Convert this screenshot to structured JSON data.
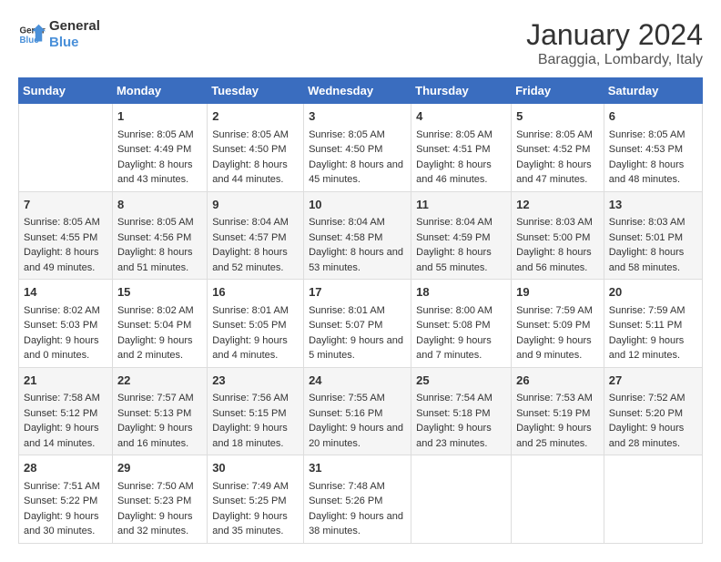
{
  "logo": {
    "line1": "General",
    "line2": "Blue"
  },
  "title": "January 2024",
  "subtitle": "Baraggia, Lombardy, Italy",
  "header": {
    "accent_color": "#3a6dbf"
  },
  "days_of_week": [
    "Sunday",
    "Monday",
    "Tuesday",
    "Wednesday",
    "Thursday",
    "Friday",
    "Saturday"
  ],
  "weeks": [
    [
      {
        "day": "",
        "sunrise": "",
        "sunset": "",
        "daylight": ""
      },
      {
        "day": "1",
        "sunrise": "Sunrise: 8:05 AM",
        "sunset": "Sunset: 4:49 PM",
        "daylight": "Daylight: 8 hours and 43 minutes."
      },
      {
        "day": "2",
        "sunrise": "Sunrise: 8:05 AM",
        "sunset": "Sunset: 4:50 PM",
        "daylight": "Daylight: 8 hours and 44 minutes."
      },
      {
        "day": "3",
        "sunrise": "Sunrise: 8:05 AM",
        "sunset": "Sunset: 4:50 PM",
        "daylight": "Daylight: 8 hours and 45 minutes."
      },
      {
        "day": "4",
        "sunrise": "Sunrise: 8:05 AM",
        "sunset": "Sunset: 4:51 PM",
        "daylight": "Daylight: 8 hours and 46 minutes."
      },
      {
        "day": "5",
        "sunrise": "Sunrise: 8:05 AM",
        "sunset": "Sunset: 4:52 PM",
        "daylight": "Daylight: 8 hours and 47 minutes."
      },
      {
        "day": "6",
        "sunrise": "Sunrise: 8:05 AM",
        "sunset": "Sunset: 4:53 PM",
        "daylight": "Daylight: 8 hours and 48 minutes."
      }
    ],
    [
      {
        "day": "7",
        "sunrise": "Sunrise: 8:05 AM",
        "sunset": "Sunset: 4:55 PM",
        "daylight": "Daylight: 8 hours and 49 minutes."
      },
      {
        "day": "8",
        "sunrise": "Sunrise: 8:05 AM",
        "sunset": "Sunset: 4:56 PM",
        "daylight": "Daylight: 8 hours and 51 minutes."
      },
      {
        "day": "9",
        "sunrise": "Sunrise: 8:04 AM",
        "sunset": "Sunset: 4:57 PM",
        "daylight": "Daylight: 8 hours and 52 minutes."
      },
      {
        "day": "10",
        "sunrise": "Sunrise: 8:04 AM",
        "sunset": "Sunset: 4:58 PM",
        "daylight": "Daylight: 8 hours and 53 minutes."
      },
      {
        "day": "11",
        "sunrise": "Sunrise: 8:04 AM",
        "sunset": "Sunset: 4:59 PM",
        "daylight": "Daylight: 8 hours and 55 minutes."
      },
      {
        "day": "12",
        "sunrise": "Sunrise: 8:03 AM",
        "sunset": "Sunset: 5:00 PM",
        "daylight": "Daylight: 8 hours and 56 minutes."
      },
      {
        "day": "13",
        "sunrise": "Sunrise: 8:03 AM",
        "sunset": "Sunset: 5:01 PM",
        "daylight": "Daylight: 8 hours and 58 minutes."
      }
    ],
    [
      {
        "day": "14",
        "sunrise": "Sunrise: 8:02 AM",
        "sunset": "Sunset: 5:03 PM",
        "daylight": "Daylight: 9 hours and 0 minutes."
      },
      {
        "day": "15",
        "sunrise": "Sunrise: 8:02 AM",
        "sunset": "Sunset: 5:04 PM",
        "daylight": "Daylight: 9 hours and 2 minutes."
      },
      {
        "day": "16",
        "sunrise": "Sunrise: 8:01 AM",
        "sunset": "Sunset: 5:05 PM",
        "daylight": "Daylight: 9 hours and 4 minutes."
      },
      {
        "day": "17",
        "sunrise": "Sunrise: 8:01 AM",
        "sunset": "Sunset: 5:07 PM",
        "daylight": "Daylight: 9 hours and 5 minutes."
      },
      {
        "day": "18",
        "sunrise": "Sunrise: 8:00 AM",
        "sunset": "Sunset: 5:08 PM",
        "daylight": "Daylight: 9 hours and 7 minutes."
      },
      {
        "day": "19",
        "sunrise": "Sunrise: 7:59 AM",
        "sunset": "Sunset: 5:09 PM",
        "daylight": "Daylight: 9 hours and 9 minutes."
      },
      {
        "day": "20",
        "sunrise": "Sunrise: 7:59 AM",
        "sunset": "Sunset: 5:11 PM",
        "daylight": "Daylight: 9 hours and 12 minutes."
      }
    ],
    [
      {
        "day": "21",
        "sunrise": "Sunrise: 7:58 AM",
        "sunset": "Sunset: 5:12 PM",
        "daylight": "Daylight: 9 hours and 14 minutes."
      },
      {
        "day": "22",
        "sunrise": "Sunrise: 7:57 AM",
        "sunset": "Sunset: 5:13 PM",
        "daylight": "Daylight: 9 hours and 16 minutes."
      },
      {
        "day": "23",
        "sunrise": "Sunrise: 7:56 AM",
        "sunset": "Sunset: 5:15 PM",
        "daylight": "Daylight: 9 hours and 18 minutes."
      },
      {
        "day": "24",
        "sunrise": "Sunrise: 7:55 AM",
        "sunset": "Sunset: 5:16 PM",
        "daylight": "Daylight: 9 hours and 20 minutes."
      },
      {
        "day": "25",
        "sunrise": "Sunrise: 7:54 AM",
        "sunset": "Sunset: 5:18 PM",
        "daylight": "Daylight: 9 hours and 23 minutes."
      },
      {
        "day": "26",
        "sunrise": "Sunrise: 7:53 AM",
        "sunset": "Sunset: 5:19 PM",
        "daylight": "Daylight: 9 hours and 25 minutes."
      },
      {
        "day": "27",
        "sunrise": "Sunrise: 7:52 AM",
        "sunset": "Sunset: 5:20 PM",
        "daylight": "Daylight: 9 hours and 28 minutes."
      }
    ],
    [
      {
        "day": "28",
        "sunrise": "Sunrise: 7:51 AM",
        "sunset": "Sunset: 5:22 PM",
        "daylight": "Daylight: 9 hours and 30 minutes."
      },
      {
        "day": "29",
        "sunrise": "Sunrise: 7:50 AM",
        "sunset": "Sunset: 5:23 PM",
        "daylight": "Daylight: 9 hours and 32 minutes."
      },
      {
        "day": "30",
        "sunrise": "Sunrise: 7:49 AM",
        "sunset": "Sunset: 5:25 PM",
        "daylight": "Daylight: 9 hours and 35 minutes."
      },
      {
        "day": "31",
        "sunrise": "Sunrise: 7:48 AM",
        "sunset": "Sunset: 5:26 PM",
        "daylight": "Daylight: 9 hours and 38 minutes."
      },
      {
        "day": "",
        "sunrise": "",
        "sunset": "",
        "daylight": ""
      },
      {
        "day": "",
        "sunrise": "",
        "sunset": "",
        "daylight": ""
      },
      {
        "day": "",
        "sunrise": "",
        "sunset": "",
        "daylight": ""
      }
    ]
  ]
}
